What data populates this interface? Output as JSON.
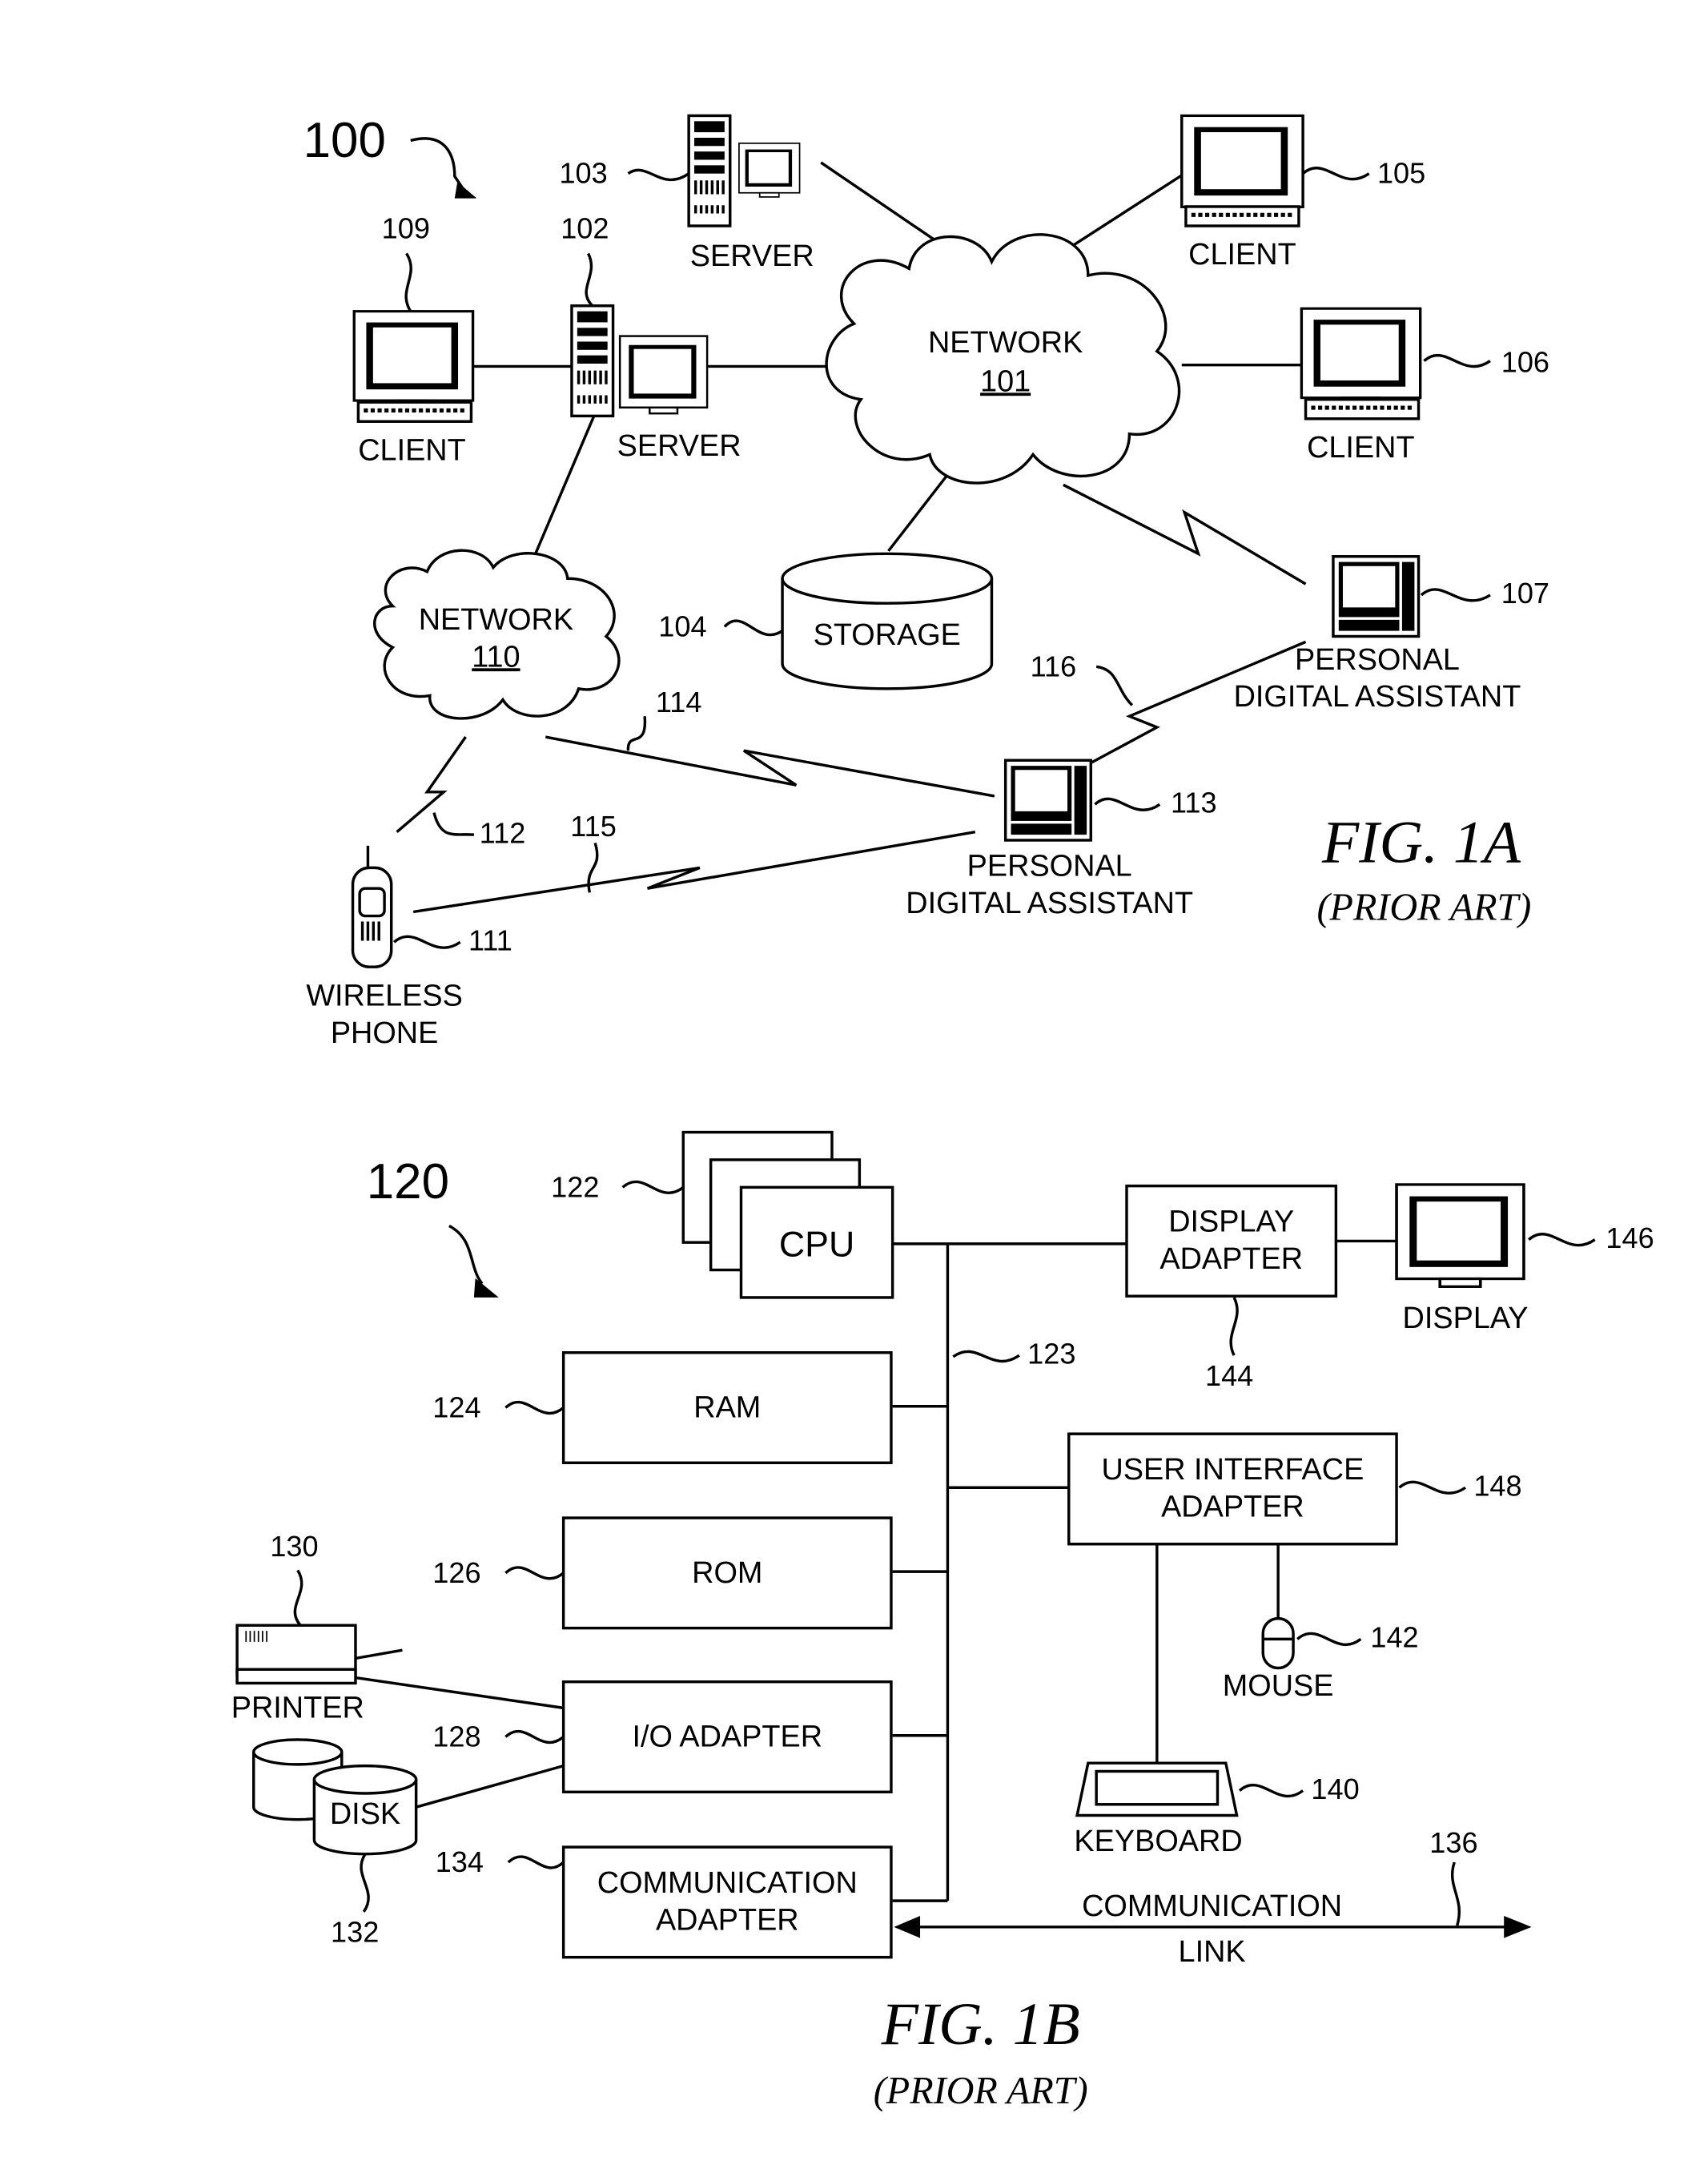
{
  "fig1a": {
    "system_ref": "100",
    "title": "FIG. 1A",
    "subtitle": "(PRIOR ART)",
    "network_101": {
      "label": "NETWORK",
      "ref": "101"
    },
    "network_110": {
      "label": "NETWORK",
      "ref": "110"
    },
    "server_103": {
      "label": "SERVER",
      "ref": "103"
    },
    "server_102": {
      "label": "SERVER",
      "ref": "102"
    },
    "client_109": {
      "label": "CLIENT",
      "ref": "109"
    },
    "client_105": {
      "label": "CLIENT",
      "ref": "105"
    },
    "client_106": {
      "label": "CLIENT",
      "ref": "106"
    },
    "storage_104": {
      "label": "STORAGE",
      "ref": "104"
    },
    "pda_107": {
      "label_line1": "PERSONAL",
      "label_line2": "DIGITAL ASSISTANT",
      "ref": "107"
    },
    "pda_113": {
      "label_line1": "PERSONAL",
      "label_line2": "DIGITAL ASSISTANT",
      "ref": "113"
    },
    "phone_111": {
      "label_line1": "WIRELESS",
      "label_line2": "PHONE",
      "ref": "111"
    },
    "links": {
      "l112": "112",
      "l114": "114",
      "l115": "115",
      "l116": "116"
    }
  },
  "fig1b": {
    "system_ref": "120",
    "title": "FIG. 1B",
    "subtitle": "(PRIOR ART)",
    "cpu": {
      "label": "CPU",
      "ref": "122"
    },
    "bus_ref": "123",
    "ram": {
      "label": "RAM",
      "ref": "124"
    },
    "rom": {
      "label": "ROM",
      "ref": "126"
    },
    "io_adapter": {
      "label": "I/O ADAPTER",
      "ref": "128"
    },
    "comm_adapter": {
      "label_line1": "COMMUNICATION",
      "label_line2": "ADAPTER",
      "ref": "134"
    },
    "display_adapter": {
      "label_line1": "DISPLAY",
      "label_line2": "ADAPTER",
      "ref": "144"
    },
    "display": {
      "label": "DISPLAY",
      "ref": "146"
    },
    "ui_adapter": {
      "label_line1": "USER INTERFACE",
      "label_line2": "ADAPTER",
      "ref": "148"
    },
    "mouse": {
      "label": "MOUSE",
      "ref": "142"
    },
    "keyboard": {
      "label": "KEYBOARD",
      "ref": "140"
    },
    "printer": {
      "label": "PRINTER",
      "ref": "130"
    },
    "disk": {
      "label": "DISK",
      "ref": "132"
    },
    "comm_link": {
      "label_line1": "COMMUNICATION",
      "label_line2": "LINK",
      "ref": "136"
    }
  }
}
